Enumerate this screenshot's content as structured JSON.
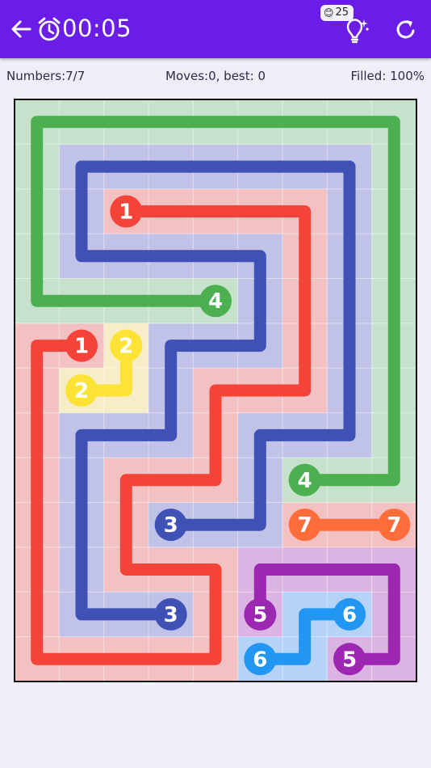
{
  "header": {
    "timer": "00:05",
    "hint_count": "25",
    "bg_color": "#6a1de6",
    "icons": [
      "back-arrow-icon",
      "alarm-clock-icon",
      "hint-bulb-icon",
      "refresh-icon"
    ]
  },
  "stats": {
    "numbers": "Numbers:7/7",
    "moves": "Moves:0, best: 0",
    "filled": "Filled: 100%"
  },
  "board": {
    "cols": 9,
    "rows": 13,
    "colors": {
      "1": {
        "line": "#f4443a",
        "fill": "#f4c1c3"
      },
      "2": {
        "line": "#fde336",
        "fill": "#f7edc8"
      },
      "3": {
        "line": "#3f51b5",
        "fill": "#c1c2e8"
      },
      "4": {
        "line": "#4caf50",
        "fill": "#c6e1cc"
      },
      "5": {
        "line": "#9c27b0",
        "fill": "#dcb4e3"
      },
      "6": {
        "line": "#2196f3",
        "fill": "#b5d2f7"
      },
      "7": {
        "line": "#ff6d3a",
        "fill": "#f4c1c3"
      }
    },
    "paths": [
      {
        "id": "1",
        "cells": [
          [
            2,
            2
          ],
          [
            3,
            2
          ],
          [
            4,
            2
          ],
          [
            5,
            2
          ],
          [
            6,
            2
          ],
          [
            6,
            3
          ],
          [
            6,
            4
          ],
          [
            6,
            5
          ],
          [
            6,
            6
          ],
          [
            5,
            6
          ],
          [
            4,
            6
          ],
          [
            4,
            7
          ],
          [
            4,
            8
          ],
          [
            3,
            8
          ],
          [
            2,
            8
          ],
          [
            2,
            9
          ],
          [
            2,
            10
          ],
          [
            3,
            10
          ],
          [
            4,
            10
          ],
          [
            4,
            11
          ],
          [
            4,
            12
          ],
          [
            3,
            12
          ],
          [
            2,
            12
          ],
          [
            1,
            12
          ],
          [
            0,
            12
          ],
          [
            0,
            11
          ],
          [
            0,
            10
          ],
          [
            0,
            9
          ],
          [
            0,
            8
          ],
          [
            0,
            7
          ],
          [
            0,
            6
          ],
          [
            0,
            5
          ],
          [
            1,
            5
          ]
        ]
      },
      {
        "id": "2",
        "cells": [
          [
            2,
            5
          ],
          [
            2,
            6
          ],
          [
            1,
            6
          ]
        ]
      },
      {
        "id": "3",
        "cells": [
          [
            3,
            9
          ],
          [
            4,
            9
          ],
          [
            5,
            9
          ],
          [
            5,
            8
          ],
          [
            5,
            7
          ],
          [
            6,
            7
          ],
          [
            7,
            7
          ],
          [
            7,
            6
          ],
          [
            7,
            5
          ],
          [
            7,
            4
          ],
          [
            7,
            3
          ],
          [
            7,
            2
          ],
          [
            7,
            1
          ],
          [
            6,
            1
          ],
          [
            5,
            1
          ],
          [
            4,
            1
          ],
          [
            3,
            1
          ],
          [
            2,
            1
          ],
          [
            1,
            1
          ],
          [
            1,
            2
          ],
          [
            1,
            3
          ],
          [
            2,
            3
          ],
          [
            3,
            3
          ],
          [
            4,
            3
          ],
          [
            5,
            3
          ],
          [
            5,
            4
          ],
          [
            5,
            5
          ],
          [
            4,
            5
          ],
          [
            3,
            5
          ],
          [
            3,
            6
          ],
          [
            3,
            7
          ],
          [
            2,
            7
          ],
          [
            1,
            7
          ],
          [
            1,
            8
          ],
          [
            1,
            9
          ],
          [
            1,
            10
          ],
          [
            1,
            11
          ],
          [
            2,
            11
          ],
          [
            3,
            11
          ]
        ]
      },
      {
        "id": "4",
        "cells": [
          [
            4,
            4
          ],
          [
            3,
            4
          ],
          [
            2,
            4
          ],
          [
            1,
            4
          ],
          [
            0,
            4
          ],
          [
            0,
            3
          ],
          [
            0,
            2
          ],
          [
            0,
            1
          ],
          [
            0,
            0
          ],
          [
            1,
            0
          ],
          [
            2,
            0
          ],
          [
            3,
            0
          ],
          [
            4,
            0
          ],
          [
            5,
            0
          ],
          [
            6,
            0
          ],
          [
            7,
            0
          ],
          [
            8,
            0
          ],
          [
            8,
            1
          ],
          [
            8,
            2
          ],
          [
            8,
            3
          ],
          [
            8,
            4
          ],
          [
            8,
            5
          ],
          [
            8,
            6
          ],
          [
            8,
            7
          ],
          [
            8,
            8
          ],
          [
            7,
            8
          ],
          [
            6,
            8
          ]
        ]
      },
      {
        "id": "5",
        "cells": [
          [
            5,
            11
          ],
          [
            5,
            10
          ],
          [
            6,
            10
          ],
          [
            7,
            10
          ],
          [
            8,
            10
          ],
          [
            8,
            11
          ],
          [
            8,
            12
          ],
          [
            7,
            12
          ]
        ]
      },
      {
        "id": "6",
        "cells": [
          [
            5,
            12
          ],
          [
            6,
            12
          ],
          [
            6,
            11
          ],
          [
            7,
            11
          ]
        ]
      },
      {
        "id": "7",
        "cells": [
          [
            6,
            9
          ],
          [
            7,
            9
          ],
          [
            8,
            9
          ]
        ]
      }
    ],
    "endpoints": [
      {
        "label": "1",
        "col": 2,
        "row": 2
      },
      {
        "label": "1",
        "col": 1,
        "row": 5
      },
      {
        "label": "2",
        "col": 2,
        "row": 5
      },
      {
        "label": "2",
        "col": 1,
        "row": 6
      },
      {
        "label": "3",
        "col": 3,
        "row": 9
      },
      {
        "label": "3",
        "col": 3,
        "row": 11
      },
      {
        "label": "4",
        "col": 4,
        "row": 4
      },
      {
        "label": "4",
        "col": 6,
        "row": 8
      },
      {
        "label": "5",
        "col": 5,
        "row": 11
      },
      {
        "label": "5",
        "col": 7,
        "row": 12
      },
      {
        "label": "6",
        "col": 7,
        "row": 11
      },
      {
        "label": "6",
        "col": 5,
        "row": 12
      },
      {
        "label": "7",
        "col": 6,
        "row": 9
      },
      {
        "label": "7",
        "col": 8,
        "row": 9
      }
    ]
  }
}
